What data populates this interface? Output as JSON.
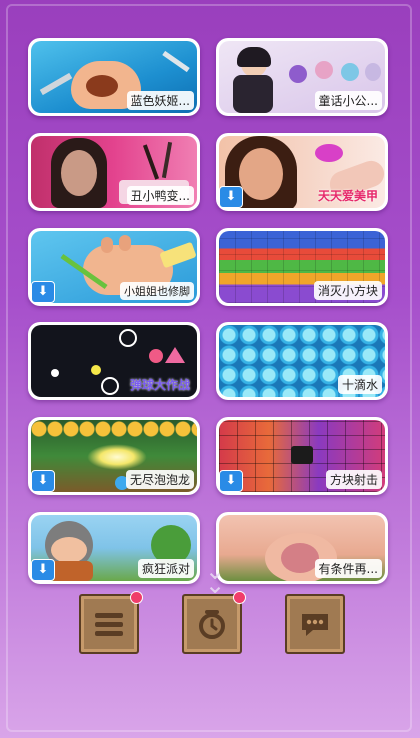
{
  "games": [
    {
      "title": "蓝色妖姬...",
      "download": false,
      "title_style": "normal"
    },
    {
      "title": "童话小公...",
      "download": false,
      "title_style": "normal"
    },
    {
      "title": "丑小鸭变...",
      "download": false,
      "title_style": "normal"
    },
    {
      "title": "天天爱美甲",
      "download": true,
      "title_style": "pink"
    },
    {
      "title": "小姐姐也修脚",
      "download": true,
      "title_style": "normal"
    },
    {
      "title": "消灭小方块",
      "download": false,
      "title_style": "normal"
    },
    {
      "title": "弹球大作战",
      "download": false,
      "title_style": "normal"
    },
    {
      "title": "十滴水",
      "download": false,
      "title_style": "normal"
    },
    {
      "title": "无尽泡泡龙",
      "download": true,
      "title_style": "normal"
    },
    {
      "title": "方块射击",
      "download": true,
      "title_style": "normal"
    },
    {
      "title": "疯狂派对",
      "download": true,
      "title_style": "normal"
    },
    {
      "title": "有条件再...",
      "download": false,
      "title_style": "normal"
    }
  ],
  "dock": {
    "buttons": [
      {
        "name": "menu",
        "icon": "menu-icon",
        "badge": true
      },
      {
        "name": "alarm",
        "icon": "alarm-clock-icon",
        "badge": true
      },
      {
        "name": "messages",
        "icon": "chat-bubble-icon",
        "badge": false
      }
    ]
  },
  "colors": {
    "accent": "#2a8be6",
    "badge": "#f03d6a",
    "dock": "#a07a52"
  }
}
